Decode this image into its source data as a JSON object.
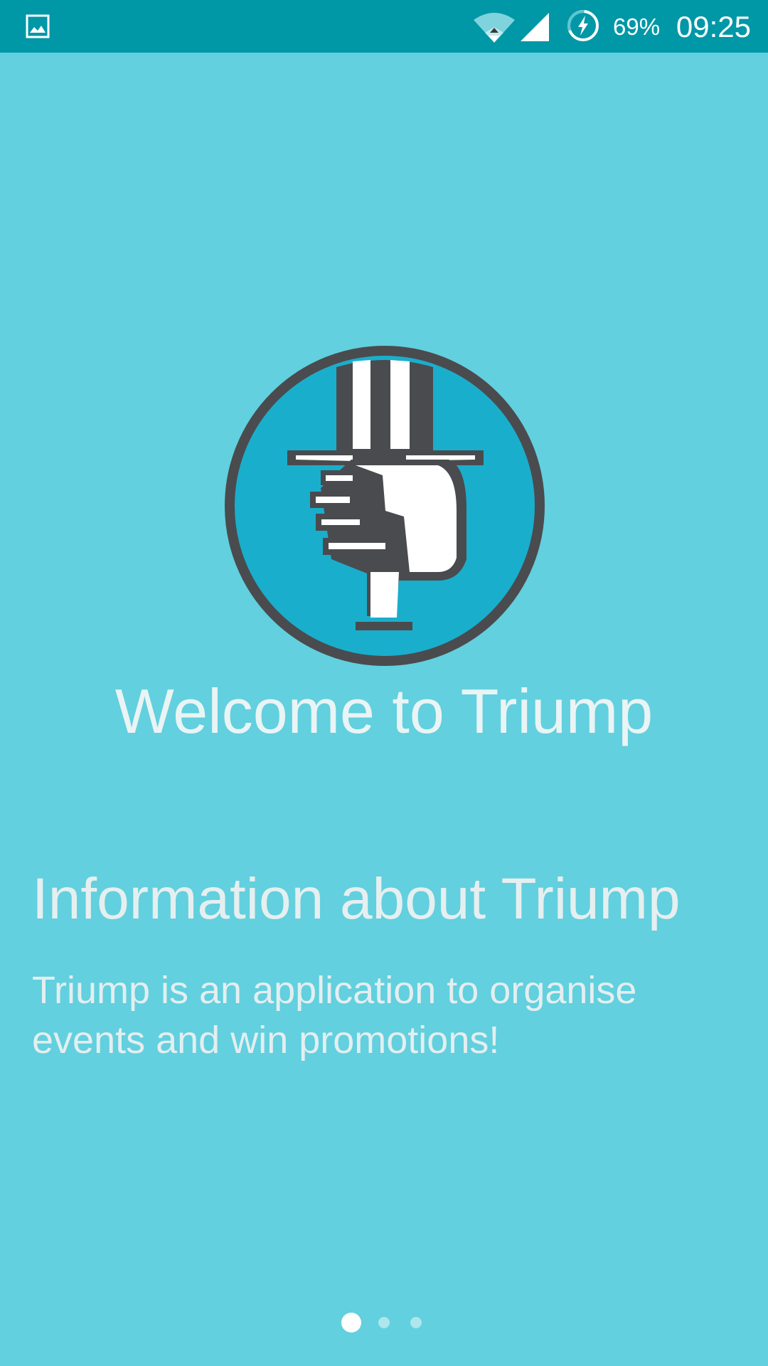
{
  "status_bar": {
    "battery_percent": "69%",
    "time": "09:25",
    "icons": [
      "image-notification-icon",
      "wifi-icon",
      "signal-icon",
      "battery-charging-icon"
    ]
  },
  "onboarding": {
    "welcome_title": "Welcome to Triump",
    "info_title": "Information about Triump",
    "info_body": "Triump is an application to organise events and win promotions!",
    "page_indicator": {
      "total": 3,
      "current": 1
    }
  },
  "colors": {
    "status_bar": "#0097a7",
    "background": "#62d0de",
    "logo_fill": "#1aaecd",
    "logo_outline": "#4a4b4e"
  }
}
